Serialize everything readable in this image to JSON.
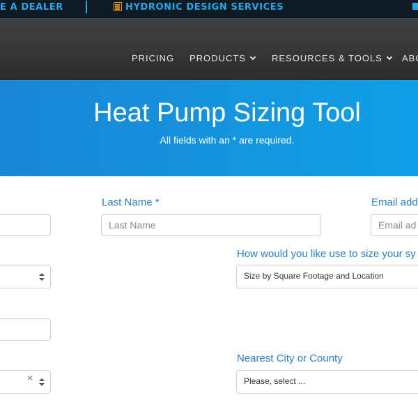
{
  "topbar": {
    "dealer_text": "E A DEALER",
    "hydronic_text": "HYDRONIC DESIGN SERVICES",
    "hydronic_icon": "calculator-icon",
    "mail_icon": "envelope-icon",
    "accent_color": "#2aa7e6",
    "icon_color": "#f39a1e"
  },
  "nav": {
    "items": [
      {
        "label": "PRICING",
        "has_dropdown": false
      },
      {
        "label": "PRODUCTS",
        "has_dropdown": true
      },
      {
        "label": "RESOURCES & TOOLS",
        "has_dropdown": true
      },
      {
        "label": "ABO",
        "has_dropdown": false
      }
    ]
  },
  "hero": {
    "title": "Heat Pump Sizing Tool",
    "subtitle": "All fields with an * are required.",
    "background_color": "#1496df"
  },
  "form": {
    "last_name": {
      "label": "Last Name *",
      "placeholder": "Last Name"
    },
    "email": {
      "label": "Email add",
      "placeholder": "Email ad"
    },
    "sizing_method": {
      "label": "How would you like use to size your sy",
      "value": "Size by Square Footage and Location"
    },
    "nearest_city": {
      "label": "Nearest City or County",
      "value": "Please, select ..."
    },
    "label_color": "#2a7fc0"
  }
}
